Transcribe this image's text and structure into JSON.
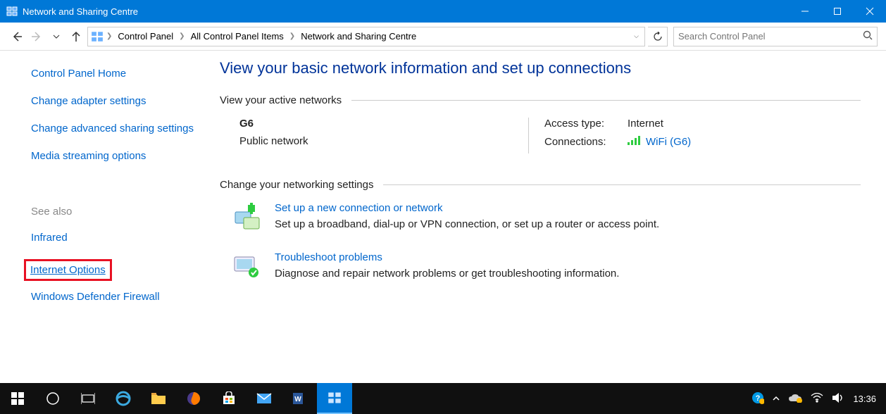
{
  "window": {
    "title": "Network and Sharing Centre"
  },
  "breadcrumb": {
    "items": [
      "Control Panel",
      "All Control Panel Items",
      "Network and Sharing Centre"
    ]
  },
  "search": {
    "placeholder": "Search Control Panel"
  },
  "sidebar": {
    "home": "Control Panel Home",
    "links": [
      "Change adapter settings",
      "Change advanced sharing settings",
      "Media streaming options"
    ],
    "see_also_label": "See also",
    "see_also": [
      "Infrared",
      "Internet Options",
      "Windows Defender Firewall"
    ]
  },
  "main": {
    "heading": "View your basic network information and set up connections",
    "active_networks_label": "View your active networks",
    "network": {
      "name": "G6",
      "type": "Public network",
      "access_label": "Access type:",
      "access_value": "Internet",
      "connections_label": "Connections:",
      "connections_link": "WiFi (G6)"
    },
    "change_label": "Change your networking settings",
    "setup": {
      "title": "Set up a new connection or network",
      "desc": "Set up a broadband, dial-up or VPN connection, or set up a router or access point."
    },
    "troubleshoot": {
      "title": "Troubleshoot problems",
      "desc": "Diagnose and repair network problems or get troubleshooting information."
    }
  },
  "taskbar": {
    "time": "13:36"
  }
}
